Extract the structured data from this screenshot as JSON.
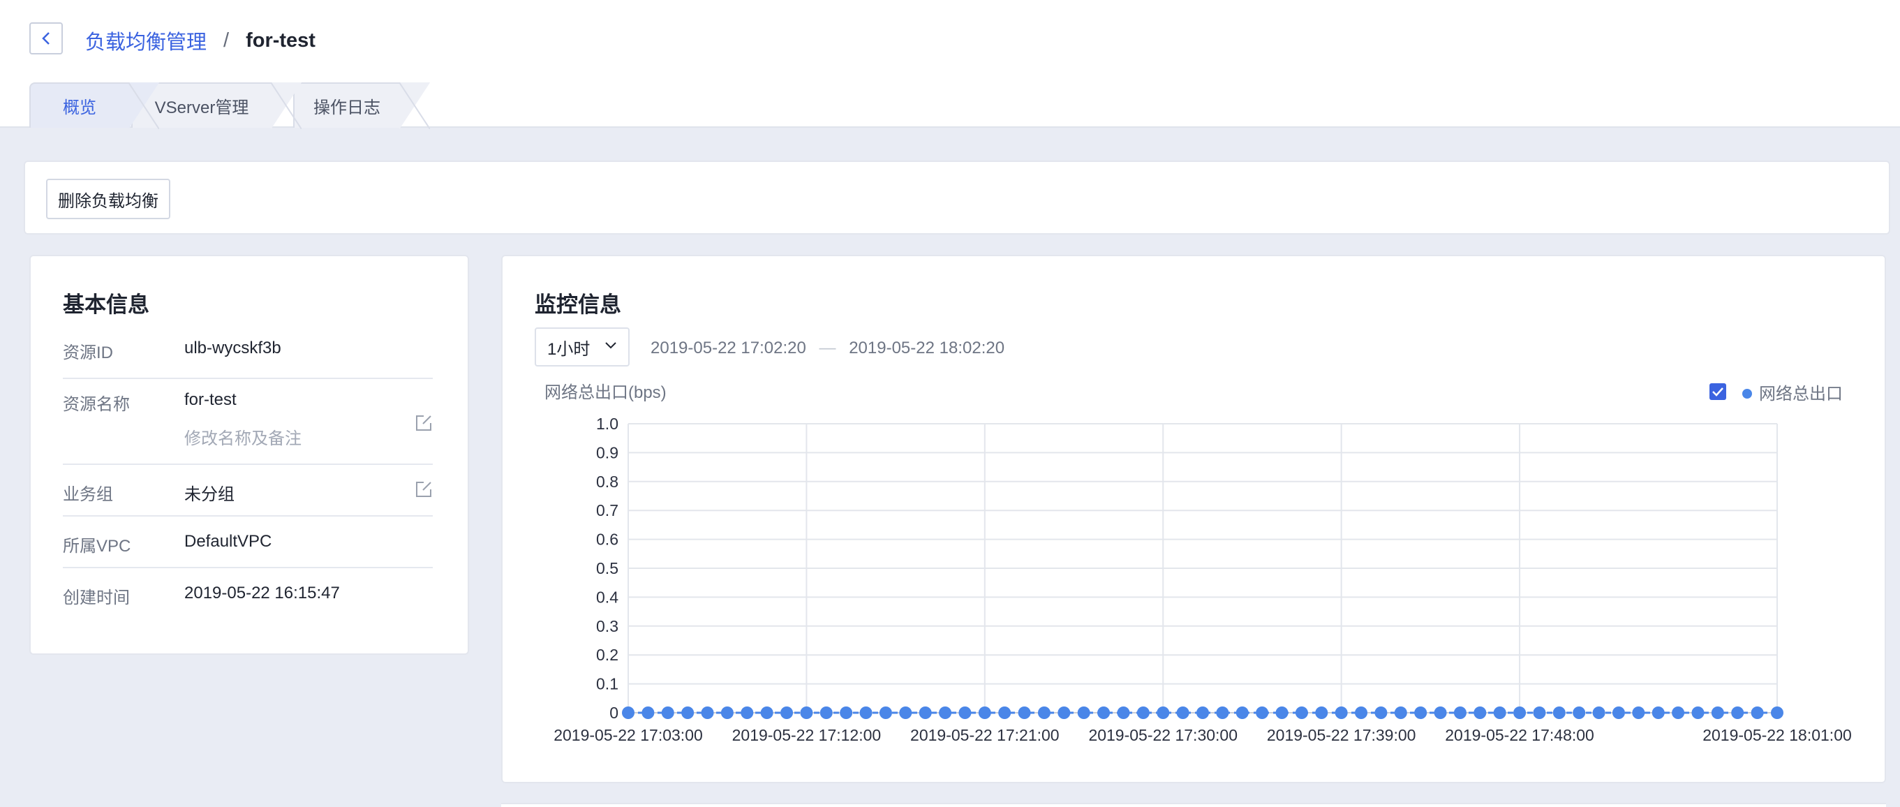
{
  "breadcrumb": {
    "parent": "负载均衡管理",
    "separator": "/",
    "current": "for-test"
  },
  "tabs": [
    {
      "label": "概览",
      "active": true
    },
    {
      "label": "VServer管理",
      "active": false
    },
    {
      "label": "操作日志",
      "active": false
    }
  ],
  "toolbar": {
    "delete_label": "删除负载均衡"
  },
  "basic_info": {
    "title": "基本信息",
    "rows": [
      {
        "label": "资源ID",
        "value": "ulb-wycskf3b"
      },
      {
        "label": "资源名称",
        "value": "for-test",
        "sub": "修改名称及备注",
        "editable": true
      },
      {
        "label": "业务组",
        "value": "未分组",
        "editable": true
      },
      {
        "label": "所属VPC",
        "value": "DefaultVPC"
      },
      {
        "label": "创建时间",
        "value": "2019-05-22 16:15:47"
      }
    ]
  },
  "monitor": {
    "title": "监控信息",
    "range_select": "1小时",
    "range_start": "2019-05-22 17:02:20",
    "range_sep": "—",
    "range_end": "2019-05-22 18:02:20"
  },
  "colors": {
    "accent": "#3b63e0",
    "series": "#4a86e8"
  },
  "chart_data": {
    "type": "line",
    "ylabel": "网络总出口(bps)",
    "ylim": [
      0,
      1.0
    ],
    "yticks": [
      "0",
      "0.1",
      "0.2",
      "0.3",
      "0.4",
      "0.5",
      "0.6",
      "0.7",
      "0.8",
      "0.9",
      "1.0"
    ],
    "xticks": [
      "2019-05-22 17:03:00",
      "2019-05-22 17:12:00",
      "2019-05-22 17:21:00",
      "2019-05-22 17:30:00",
      "2019-05-22 17:39:00",
      "2019-05-22 17:48:00",
      "2019-05-22 18:01:00"
    ],
    "x_range": [
      "2019-05-22 17:03:00",
      "2019-05-22 18:01:00"
    ],
    "grid": true,
    "legend_position": "top-right",
    "series": [
      {
        "name": "网络总出口",
        "checked": true,
        "point_count": 59,
        "constant_value": 0
      }
    ]
  }
}
